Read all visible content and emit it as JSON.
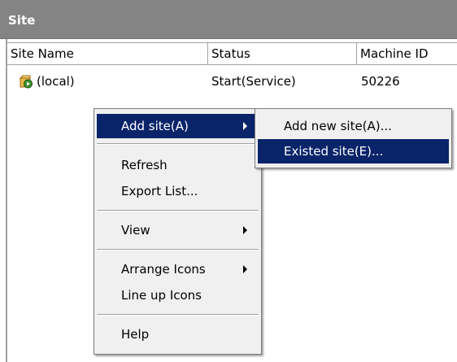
{
  "window": {
    "title": "Site"
  },
  "columns": [
    {
      "label": "Site Name"
    },
    {
      "label": "Status"
    },
    {
      "label": "Machine ID"
    }
  ],
  "rows": [
    {
      "name": "(local)",
      "status": "Start(Service)",
      "machine_id": "50226"
    }
  ],
  "context_menu": {
    "items": [
      {
        "label": "Add site(A)",
        "submenu": true,
        "active": true
      },
      {
        "label": "Refresh"
      },
      {
        "label": "Export List..."
      },
      {
        "label": "View",
        "submenu": true
      },
      {
        "label": "Arrange Icons",
        "submenu": true
      },
      {
        "label": "Line up Icons"
      },
      {
        "label": "Help"
      }
    ]
  },
  "submenu": {
    "items": [
      {
        "label": "Add new site(A)..."
      },
      {
        "label": "Existed site(E)...",
        "active": true
      }
    ]
  },
  "colors": {
    "titlebar": "#848484",
    "highlight": "#0a246a",
    "menu_bg": "#f0f0f0"
  },
  "icons": {
    "site_row": "site-service-icon"
  }
}
